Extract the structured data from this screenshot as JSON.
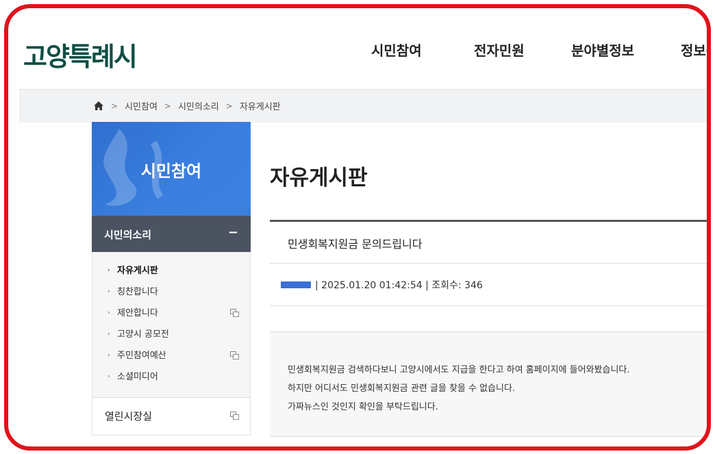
{
  "header": {
    "logo": "고양특례시",
    "nav": [
      "시민참여",
      "전자민원",
      "분야별정보",
      "정보공"
    ]
  },
  "breadcrumb": [
    "시민참여",
    "시민의소리",
    "자유게시판"
  ],
  "sidebar": {
    "title": "시민참여",
    "section": "시민의소리",
    "section_toggle": "−",
    "items": [
      {
        "label": "자유게시판",
        "active": true,
        "new_window": false
      },
      {
        "label": "칭찬합니다",
        "active": false,
        "new_window": false
      },
      {
        "label": "제안합니다",
        "active": false,
        "new_window": true
      },
      {
        "label": "고양시 공모전",
        "active": false,
        "new_window": false
      },
      {
        "label": "주민참여예산",
        "active": false,
        "new_window": true
      },
      {
        "label": "소셜미디어",
        "active": false,
        "new_window": false
      }
    ],
    "extra": "열린시장실"
  },
  "content": {
    "page_title": "자유게시판",
    "post": {
      "subject": "민생회복지원금 문의드립니다",
      "meta": "| 2025.01.20 01:42:54 | 조회수: 346",
      "body": [
        "민생회복지원금 검색하다보니 고양시에서도 지급을 한다고 하여 홈페이지에 들어와봤습니다.",
        "하지만 어디서도 민생회복지원금 관련 글을 찾을 수 없습니다.",
        "가짜뉴스인 것인지 확인을 부탁드립니다."
      ]
    }
  },
  "colors": {
    "frame": "#e2121b",
    "logo": "#0f4f45",
    "sidebar_title_bg": "#3a7fe0",
    "sidebar_section_bg": "#4b5360"
  }
}
